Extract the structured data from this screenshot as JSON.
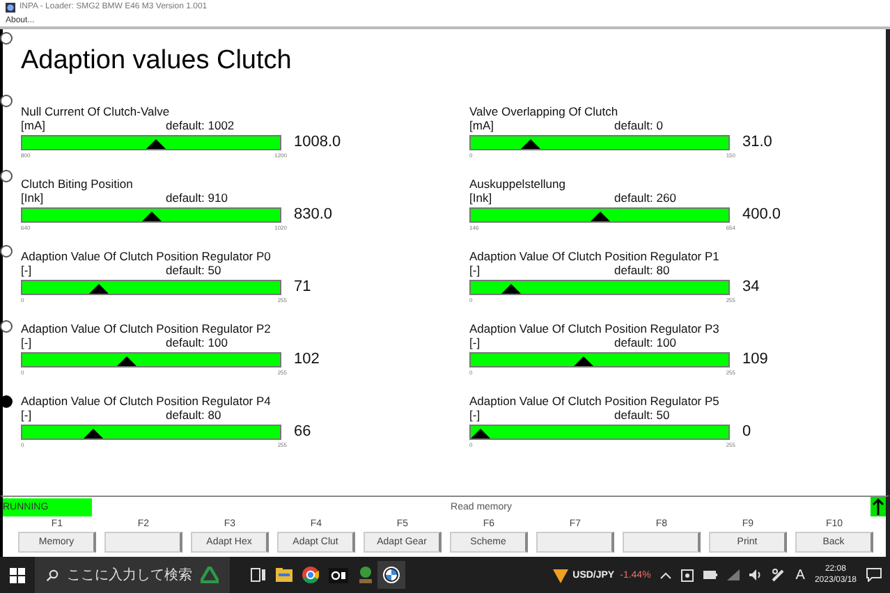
{
  "window": {
    "title": "INPA - Loader:  SMG2 BMW E46 M3 Version 1.001"
  },
  "menu": [
    "About..."
  ],
  "page_title": "Adaption values Clutch",
  "radio_markers": [
    {
      "selected": false
    },
    {
      "selected": false
    },
    {
      "selected": false
    },
    {
      "selected": false
    },
    {
      "selected": false
    },
    {
      "selected": true
    }
  ],
  "gauges": [
    {
      "name": "Null Current Of Clutch-Valve",
      "unit": "[mA]",
      "default": "default: 1002",
      "value": "1008.0",
      "min": "800",
      "max": "1200",
      "level": 0.52
    },
    {
      "name": "Valve Overlapping Of Clutch",
      "unit": "[mA]",
      "default": "default: 0",
      "value": "31.0",
      "min": "0",
      "max": "150",
      "level": 0.21
    },
    {
      "name": "Clutch Biting Position",
      "unit": "[Ink]",
      "default": "default: 910",
      "value": "830.0",
      "min": "640",
      "max": "1020",
      "level": 0.5
    },
    {
      "name": "Auskuppelstellung",
      "unit": "[Ink]",
      "default": "default: 260",
      "value": "400.0",
      "min": "146",
      "max": "654",
      "level": 0.5
    },
    {
      "name": "Adaption Value Of Clutch Position Regulator P0",
      "unit": "[-]",
      "default": "default: 50",
      "value": "71",
      "min": "0",
      "max": "255",
      "level": 0.28
    },
    {
      "name": "Adaption Value Of Clutch Position Regulator P1",
      "unit": "[-]",
      "default": "default: 80",
      "value": "34",
      "min": "0",
      "max": "255",
      "level": 0.13
    },
    {
      "name": "Adaption Value Of Clutch Position Regulator P2",
      "unit": "[-]",
      "default": "default: 100",
      "value": "102",
      "min": "0",
      "max": "255",
      "level": 0.4
    },
    {
      "name": "Adaption Value Of Clutch Position Regulator P3",
      "unit": "[-]",
      "default": "default: 100",
      "value": "109",
      "min": "0",
      "max": "255",
      "level": 0.43
    },
    {
      "name": "Adaption Value Of Clutch Position Regulator P4",
      "unit": "[-]",
      "default": "default: 80",
      "value": "66",
      "min": "0",
      "max": "255",
      "level": 0.26
    },
    {
      "name": "Adaption Value Of Clutch Position Regulator P5",
      "unit": "[-]",
      "default": "default: 50",
      "value": "0",
      "min": "0",
      "max": "255"
    }
  ],
  "status": {
    "state": "RUNNING",
    "message": "Read memory"
  },
  "function_keys": [
    {
      "key": "F1",
      "label": "Memory"
    },
    {
      "key": "F2"
    },
    {
      "key": "F3",
      "label": "Adapt Hex"
    },
    {
      "key": "F4",
      "label": "Adapt Clut"
    },
    {
      "key": "F5",
      "label": "Adapt Gear"
    },
    {
      "key": "F6",
      "label": "Scheme"
    },
    {
      "key": "F7"
    },
    {
      "key": "F8"
    },
    {
      "key": "F9",
      "label": "Print"
    },
    {
      "key": "F10",
      "label": "Back"
    }
  ],
  "taskbar": {
    "search_placeholder": "ここに入力して検索",
    "ticker_symbol": "USD/JPY",
    "ticker_change": "-1.44%",
    "ime": "A",
    "time": "22:08",
    "date": "2023/03/18"
  }
}
